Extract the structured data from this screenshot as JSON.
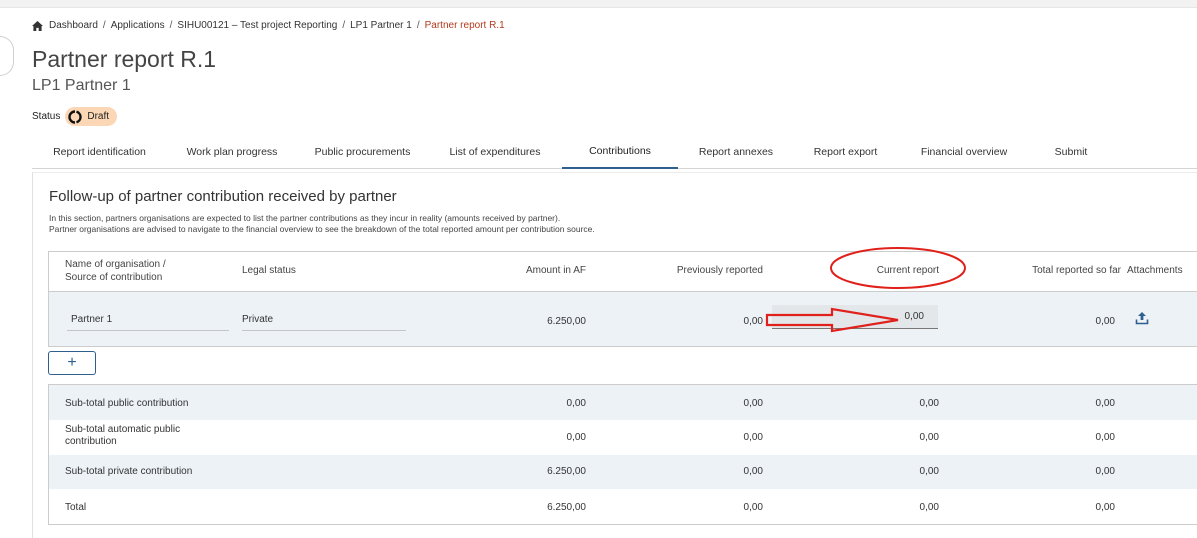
{
  "breadcrumb": {
    "items": [
      "Dashboard",
      "Applications",
      "SIHU00121 – Test project Reporting",
      "LP1 Partner 1"
    ],
    "current": "Partner report R.1",
    "separator": "/"
  },
  "page": {
    "title": "Partner report R.1",
    "subtitle": "LP1 Partner 1",
    "status_label": "Status",
    "status_value": "Draft"
  },
  "tabs": [
    "Report identification",
    "Work plan progress",
    "Public procurements",
    "List of expenditures",
    "Contributions",
    "Report annexes",
    "Report export",
    "Financial overview",
    "Submit"
  ],
  "active_tab": "Contributions",
  "section": {
    "title": "Follow-up of partner contribution received by partner",
    "desc_line1": "In this section, partners organisations are expected to list the partner contributions as they incur in reality (amounts received by partner).",
    "desc_line2": "Partner organisations are advised to navigate to the financial overview to see the breakdown of the total reported amount per contribution source."
  },
  "table": {
    "headers": {
      "name_line1": "Name of organisation /",
      "name_line2": "Source of contribution",
      "legal_status": "Legal status",
      "amount_af": "Amount in AF",
      "previously": "Previously reported",
      "current": "Current report",
      "total": "Total reported so far",
      "attachments": "Attachments"
    },
    "row": {
      "name": "Partner 1",
      "legal_status": "Private",
      "amount_af": "6.250,00",
      "previously": "0,00",
      "current": "0,00",
      "total": "0,00"
    }
  },
  "add_button_label": "+",
  "totals": [
    {
      "label": "Sub-total public contribution",
      "amount_af": "0,00",
      "previously": "0,00",
      "current": "0,00",
      "total": "0,00"
    },
    {
      "label_line1": "Sub-total automatic public",
      "label_line2": "contribution",
      "amount_af": "0,00",
      "previously": "0,00",
      "current": "0,00",
      "total": "0,00"
    },
    {
      "label": "Sub-total private contribution",
      "amount_af": "6.250,00",
      "previously": "0,00",
      "current": "0,00",
      "total": "0,00"
    },
    {
      "label": "Total",
      "amount_af": "6.250,00",
      "previously": "0,00",
      "current": "0,00",
      "total": "0,00"
    }
  ],
  "icons": {
    "home": "home-icon",
    "status": "status-circle-icon",
    "upload": "upload-icon"
  },
  "colors": {
    "accent": "#2f5f8e",
    "breadcrumb_current": "#b23a1c",
    "status_badge": "#fbd7b5",
    "annotation_red": "#e0211b",
    "row_shade": "#edf2f7"
  }
}
